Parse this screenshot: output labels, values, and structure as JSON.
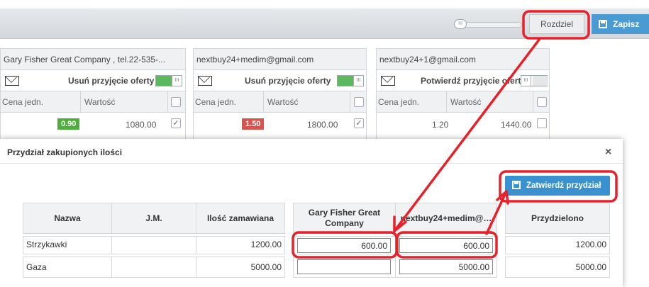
{
  "toolbar": {
    "split_label": "Rozdziel",
    "save_label": "Zapisz",
    "slider_knob": "III"
  },
  "cards": [
    {
      "title": "Gary Fisher Great Company , tel.22-535-...",
      "action_label": "Usuń przyjęcie oferty",
      "toggle_on": true,
      "col_price": "Cena jedn.",
      "col_value": "Wartość",
      "price": "0.90",
      "price_color": "#4caf3a",
      "value": "1080.00",
      "checked": true
    },
    {
      "title": "nextbuy24+medim@gmail.com",
      "action_label": "Usuń przyjęcie oferty",
      "toggle_on": true,
      "col_price": "Cena jedn.",
      "col_value": "Wartość",
      "price": "1.50",
      "price_color": "#d9534f",
      "value": "1800.00",
      "checked": true
    },
    {
      "title": "nextbuy24+1@gmail.com",
      "action_label": "Potwierdź przyjęcie oferty",
      "toggle_on": false,
      "col_price": "Cena jedn.",
      "col_value": "Wartość",
      "price": "1.20",
      "price_color": "",
      "value": "1440.00",
      "checked": false
    }
  ],
  "modal": {
    "title": "Przydział zakupionych ilości",
    "close": "×",
    "confirm_label": "Zatwierdź przydział",
    "table": {
      "headers": [
        "Nazwa",
        "J.M.",
        "Ilość zamawiana",
        "Gary Fisher Great Company",
        "nextbuy24+medim@…",
        "Przydzielono"
      ],
      "rows": [
        {
          "name": "Strzykawki",
          "unit": "",
          "qty": "1200.00",
          "s1": "600.00",
          "s2": "600.00",
          "assigned": "1200.00"
        },
        {
          "name": "Gaza",
          "unit": "",
          "qty": "5000.00",
          "s1": "",
          "s2": "5000.00",
          "assigned": "5000.00"
        }
      ]
    }
  },
  "colors": {
    "primary_button": "#3a91cf",
    "annotation_red": "#e8202a",
    "toggle_green": "#5cb85c"
  },
  "icons": [
    "slider-knob-icon",
    "save-icon",
    "envelope-icon",
    "toggle-switch-icon",
    "checkbox-icon",
    "close-icon"
  ]
}
